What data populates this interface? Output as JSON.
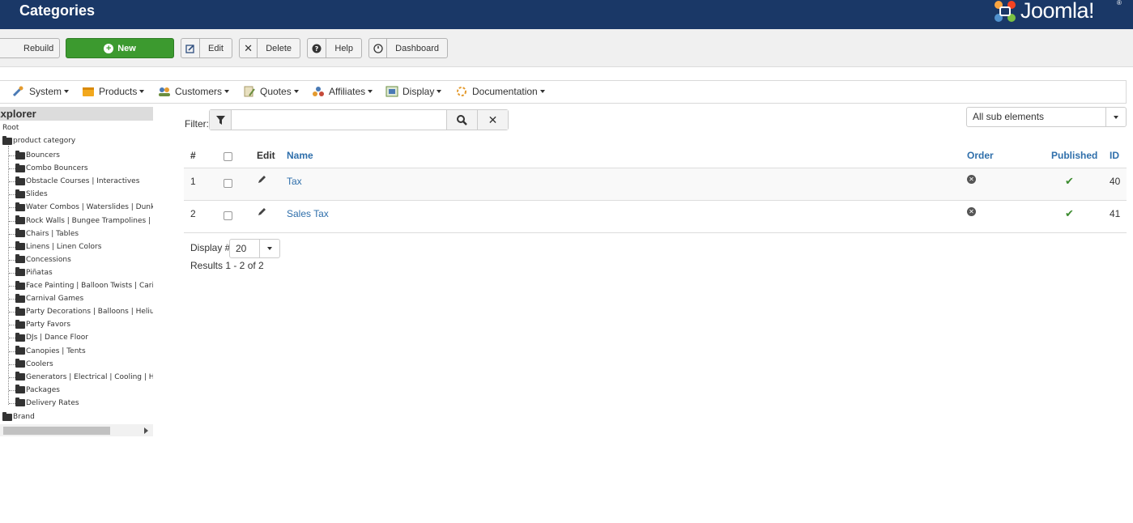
{
  "header": {
    "title": "Categories",
    "brand": "Joomla!",
    "brand_reg": "®"
  },
  "toolbar": {
    "rebuild": "Rebuild",
    "new": "New",
    "edit": "Edit",
    "delete": "Delete",
    "help": "Help",
    "dashboard": "Dashboard"
  },
  "menu": [
    {
      "label": "System",
      "icon": "wrench-icon"
    },
    {
      "label": "Products",
      "icon": "box-icon"
    },
    {
      "label": "Customers",
      "icon": "customers-icon"
    },
    {
      "label": "Quotes",
      "icon": "quotes-icon"
    },
    {
      "label": "Affiliates",
      "icon": "affiliates-icon"
    },
    {
      "label": "Display",
      "icon": "display-icon"
    },
    {
      "label": "Documentation",
      "icon": "documentation-icon"
    }
  ],
  "explorer": {
    "title": "Explorer",
    "root": "Root",
    "product_category": "product category",
    "categories": [
      "Bouncers",
      "Combo Bouncers",
      "Obstacle Courses | Interactives",
      "Slides",
      "Water Combos | Waterslides | Dunk Tanks",
      "Rock Walls | Bungee Trampolines | Ziplines",
      "Chairs | Tables",
      "Linens | Linen Colors",
      "Concessions",
      "Piñatas",
      "Face Painting | Balloon Twists | Caricatures",
      "Carnival Games",
      "Party Decorations | Balloons | Helium",
      "Party Favors",
      "DJs | Dance Floor",
      "Canopies | Tents",
      "Coolers",
      "Generators | Electrical | Cooling | Heating",
      "Packages",
      "Delivery Rates"
    ],
    "brand": "Brand"
  },
  "filter": {
    "label": "Filter:",
    "value": "",
    "placeholder": ""
  },
  "sub_elements": "All sub elements",
  "table": {
    "headers": {
      "num": "#",
      "edit": "Edit",
      "name": "Name",
      "order": "Order",
      "published": "Published",
      "id": "ID"
    },
    "rows": [
      {
        "num": "1",
        "name": "Tax",
        "id": "40",
        "published": true
      },
      {
        "num": "2",
        "name": "Sales Tax",
        "id": "41",
        "published": true
      }
    ]
  },
  "pagination": {
    "display_label": "Display #",
    "limit": "20",
    "results": "Results 1 - 2 of 2"
  },
  "colors": {
    "header_bg": "#1a3867",
    "new_button": "#3c9a2f",
    "link": "#2f6fab",
    "published_check": "#3c8b2f"
  }
}
